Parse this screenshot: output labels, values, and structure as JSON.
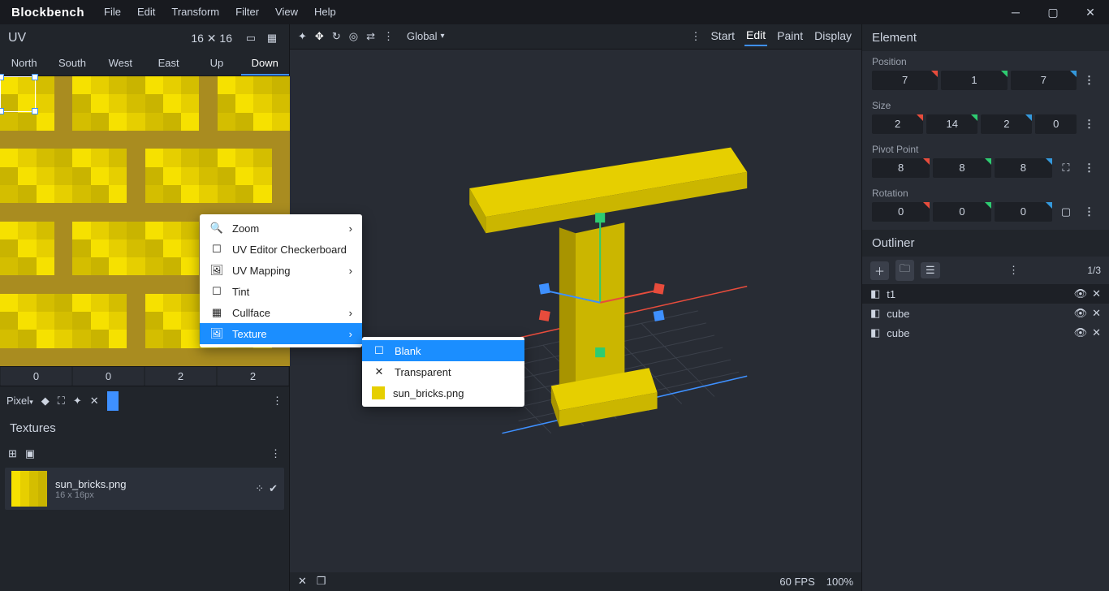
{
  "app": {
    "name": "Blockbench"
  },
  "menu": [
    "File",
    "Edit",
    "Transform",
    "Filter",
    "View",
    "Help"
  ],
  "win_controls": [
    "minimize",
    "maximize",
    "close"
  ],
  "uv": {
    "title": "UV",
    "dim": "16 ✕ 16",
    "faces": [
      "North",
      "South",
      "West",
      "East",
      "Up",
      "Down"
    ],
    "active_face": "Down",
    "coords": [
      "0",
      "0",
      "2",
      "2"
    ]
  },
  "paint_row": {
    "mode_label": "Pixel"
  },
  "textures": {
    "title": "Textures",
    "items": [
      {
        "name": "sun_bricks.png",
        "meta": "16 x 16px"
      }
    ]
  },
  "toolbar": {
    "global_label": "Global",
    "modes": [
      "Start",
      "Edit",
      "Paint",
      "Display"
    ],
    "active_mode": "Edit"
  },
  "status": {
    "fps": "60 FPS",
    "zoom": "100%"
  },
  "element": {
    "title": "Element",
    "labels": {
      "position": "Position",
      "size": "Size",
      "pivot": "Pivot Point",
      "rotation": "Rotation"
    },
    "position": [
      "7",
      "1",
      "7"
    ],
    "size": [
      "2",
      "14",
      "2",
      "0"
    ],
    "pivot": [
      "8",
      "8",
      "8"
    ],
    "rotation": [
      "0",
      "0",
      "0"
    ]
  },
  "outliner": {
    "title": "Outliner",
    "count": "1/3",
    "items": [
      {
        "name": "t1",
        "selected": true
      },
      {
        "name": "cube",
        "selected": false
      },
      {
        "name": "cube",
        "selected": false
      }
    ]
  },
  "context_menu": {
    "items": [
      {
        "label": "Zoom",
        "icon": "search",
        "submenu": true
      },
      {
        "label": "UV Editor Checkerboard",
        "icon": "checkbox"
      },
      {
        "label": "UV Mapping",
        "icon": "image",
        "submenu": true
      },
      {
        "label": "Tint",
        "icon": "checkbox"
      },
      {
        "label": "Cullface",
        "icon": "grid",
        "submenu": true
      },
      {
        "label": "Texture",
        "icon": "texture",
        "submenu": true,
        "highlight": true
      }
    ],
    "submenu": [
      {
        "label": "Blank",
        "icon": "square",
        "highlight": true
      },
      {
        "label": "Transparent",
        "icon": "x"
      },
      {
        "label": "sun_bricks.png",
        "icon": "tex"
      }
    ]
  }
}
